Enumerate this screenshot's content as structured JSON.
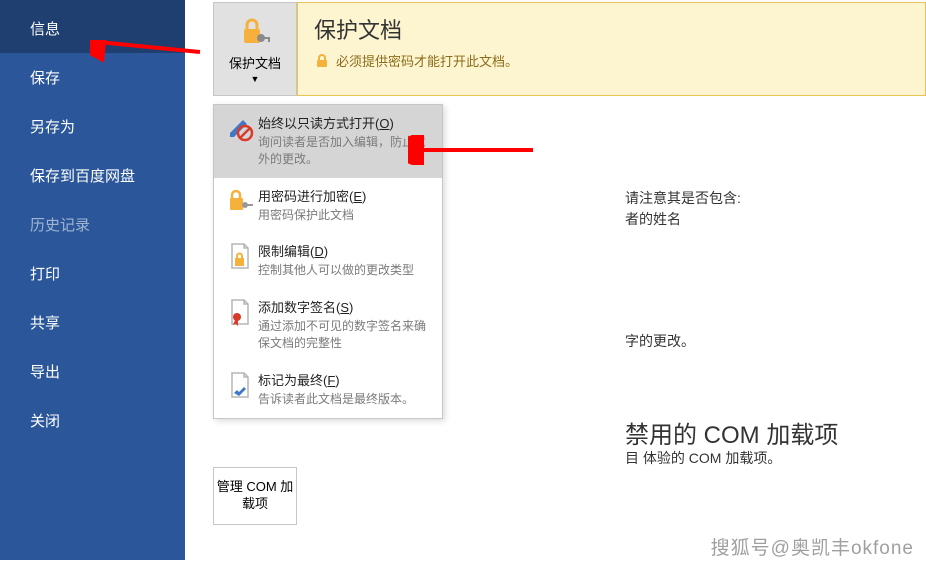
{
  "sidebar": {
    "items": [
      {
        "label": "信息",
        "selected": true
      },
      {
        "label": "保存"
      },
      {
        "label": "另存为"
      },
      {
        "label": "保存到百度网盘"
      },
      {
        "label": "历史记录",
        "disabled": true
      },
      {
        "label": "打印"
      },
      {
        "label": "共享"
      },
      {
        "label": "导出"
      },
      {
        "label": "关闭"
      }
    ]
  },
  "protect_button": {
    "label": "保护文档"
  },
  "banner": {
    "title": "保护文档",
    "message": "必须提供密码才能打开此文档。"
  },
  "menu": {
    "items": [
      {
        "title": "始终以只读方式打开(",
        "accel": "O",
        "title2": ")",
        "desc": "询问读者是否加入编辑，防止意外的更改。",
        "icon": "pencil-blocked",
        "hover": true
      },
      {
        "title": "用密码进行加密(",
        "accel": "E",
        "title2": ")",
        "desc": "用密码保护此文档",
        "icon": "lock-key"
      },
      {
        "title": "限制编辑(",
        "accel": "D",
        "title2": ")",
        "desc": "控制其他人可以做的更改类型",
        "icon": "doc-lock"
      },
      {
        "title": "添加数字签名(",
        "accel": "S",
        "title2": ")",
        "desc": "通过添加不可见的数字签名来确保文档的完整性",
        "icon": "doc-ribbon"
      },
      {
        "title": "标记为最终(",
        "accel": "F",
        "title2": ")",
        "desc": "告诉读者此文档是最终版本。",
        "icon": "doc-check"
      }
    ]
  },
  "background": {
    "line1": "请注意其是否包含:",
    "line2": "者的姓名",
    "line3": "字的更改。",
    "heading": "禁用的 COM 加载项",
    "line4": "目 体验的 COM 加载项。"
  },
  "com_button": {
    "label": "管理 COM 加载项"
  },
  "watermark": "搜狐号@奥凯丰okfone"
}
